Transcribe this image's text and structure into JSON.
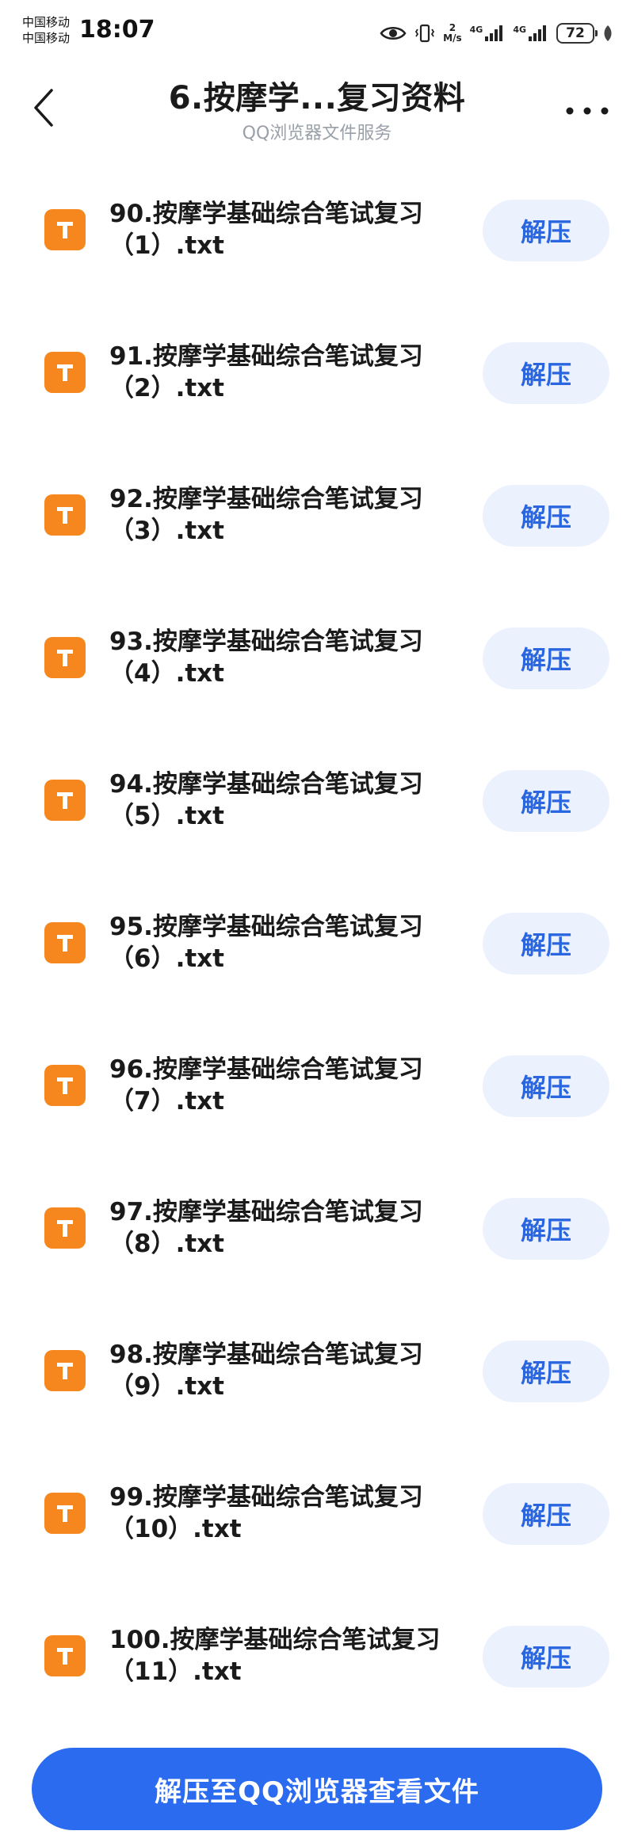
{
  "status_bar": {
    "carrier_1": "中国移动",
    "carrier_2": "中国移动",
    "time": "18:07",
    "net_speed_value": "2",
    "net_speed_unit": "M/s",
    "signal_1_label": "4G",
    "signal_2_label": "4G",
    "battery_level": "72"
  },
  "header": {
    "title": "6.按摩学...复习资料",
    "subtitle": "QQ浏览器文件服务"
  },
  "files": [
    {
      "name": "90.按摩学基础综合笔试复习（1）.txt",
      "action": "解压"
    },
    {
      "name": "91.按摩学基础综合笔试复习（2）.txt",
      "action": "解压"
    },
    {
      "name": "92.按摩学基础综合笔试复习（3）.txt",
      "action": "解压"
    },
    {
      "name": "93.按摩学基础综合笔试复习（4）.txt",
      "action": "解压"
    },
    {
      "name": "94.按摩学基础综合笔试复习（5）.txt",
      "action": "解压"
    },
    {
      "name": "95.按摩学基础综合笔试复习（6）.txt",
      "action": "解压"
    },
    {
      "name": "96.按摩学基础综合笔试复习（7）.txt",
      "action": "解压"
    },
    {
      "name": "97.按摩学基础综合笔试复习（8）.txt",
      "action": "解压"
    },
    {
      "name": "98.按摩学基础综合笔试复习（9）.txt",
      "action": "解压"
    },
    {
      "name": "99.按摩学基础综合笔试复习（10）.txt",
      "action": "解压"
    },
    {
      "name": "100.按摩学基础综合笔试复习（11）.txt",
      "action": "解压"
    }
  ],
  "bottom_button": {
    "label": "解压至QQ浏览器查看文件"
  },
  "colors": {
    "accent": "#2b6bf0",
    "file_icon": "#f6871f",
    "unzip_button_bg": "#ecf2fd",
    "unzip_button_text": "#2a66e0"
  },
  "icons": {
    "back": "chevron-left-icon",
    "more": "more-horizontal-icon",
    "file": "text-file-icon"
  }
}
